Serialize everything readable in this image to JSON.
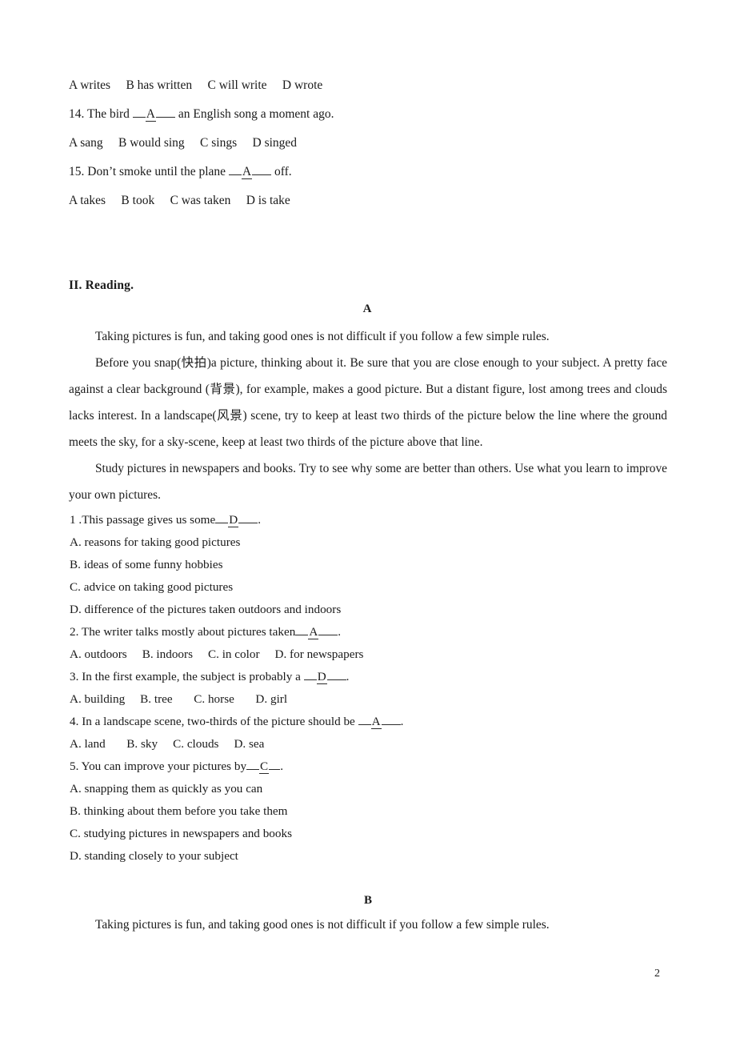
{
  "document": {
    "page_number": "2"
  },
  "grammar_section": {
    "rows": [
      {
        "id": "q13-options",
        "text": "A writes  B has written  C will write  D wrote"
      },
      {
        "id": "q14-stem",
        "prefix": "14. The bird ",
        "answer": "A",
        "suffix": " an English song a moment ago."
      },
      {
        "id": "q14-options",
        "text": "A sang  B would sing  C sings  D singed"
      },
      {
        "id": "q15-stem",
        "prefix": "15. Don’t smoke until the plane ",
        "answer": "A",
        "suffix": " off."
      },
      {
        "id": "q15-options",
        "text": "A takes  B took  C was taken  D is take"
      }
    ]
  },
  "reading": {
    "section_heading": "II. Reading.",
    "passage_a": {
      "label": "A",
      "paragraphs": [
        "Taking pictures is fun, and taking good ones is not difficult if you follow a few simple rules.",
        "Before you snap(快拍)a picture, thinking about it. Be sure that you are close enough to your subject. A pretty face against a clear background (背景), for example, makes a good picture. But a distant figure, lost among trees and clouds lacks interest. In a landscape(风景) scene, try to keep at least two thirds of the picture below the line where the ground meets the sky, for a sky-scene, keep at least two thirds of the picture above that line.",
        "Study pictures in newspapers and books. Try to see why some are better than others. Use what you learn to improve your own pictures."
      ],
      "questions": [
        {
          "stem_prefix": "1 .This passage gives us some",
          "answer": "D",
          "stem_suffix": ".",
          "options": [
            "A. reasons for taking good pictures",
            "B. ideas of some funny hobbies",
            "C. advice on taking good pictures",
            "D. difference of the pictures taken outdoors and indoors"
          ]
        },
        {
          "stem_prefix": "2. The writer talks mostly about pictures taken",
          "answer": "A",
          "stem_suffix": ".",
          "options": [
            "A. outdoors  B. indoors  C. in color  D. for newspapers"
          ]
        },
        {
          "stem_prefix": "3. In the first example, the subject is probably a ",
          "answer": "D",
          "stem_suffix": ".",
          "options": [
            "A. building  B. tree   C. horse   D. girl"
          ]
        },
        {
          "stem_prefix": "4. In a landscape scene, two-thirds of the picture should be ",
          "answer": "A",
          "stem_suffix": ".",
          "options": [
            "A. land   B. sky  C. clouds  D. sea"
          ]
        },
        {
          "stem_prefix": "5. You can improve your pictures by",
          "answer": "C",
          "stem_suffix": ".",
          "options": [
            "A. snapping them as quickly as you can",
            "B. thinking about them before you take them",
            "C. studying pictures in newspapers and books",
            "D. standing closely to your subject"
          ]
        }
      ]
    },
    "passage_b": {
      "label": "B",
      "paragraphs": [
        "Taking pictures is fun, and taking good ones is not difficult if you follow a few simple rules."
      ]
    }
  }
}
